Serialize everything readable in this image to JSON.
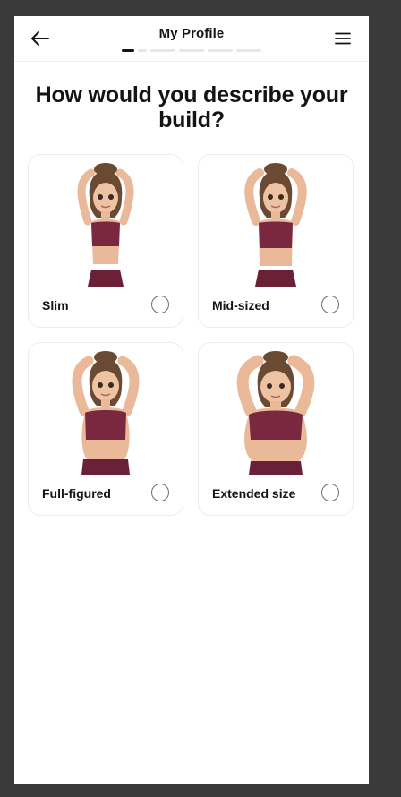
{
  "header": {
    "title": "My Profile",
    "back_icon": "arrow-left-icon",
    "menu_icon": "hamburger-menu-icon",
    "progress": {
      "current_step": 1,
      "total_steps": 5
    }
  },
  "question": "How would you describe your build?",
  "options": [
    {
      "label": "Slim",
      "selected": false,
      "figure_icon": "slim-body-figure"
    },
    {
      "label": "Mid-sized",
      "selected": false,
      "figure_icon": "mid-sized-body-figure"
    },
    {
      "label": "Full-figured",
      "selected": false,
      "figure_icon": "full-figured-body-figure"
    },
    {
      "label": "Extended size",
      "selected": false,
      "figure_icon": "extended-size-body-figure"
    }
  ],
  "colors": {
    "frame_background": "#3a3a3a",
    "screen_background": "#ffffff",
    "text": "#141414",
    "top_color": "#7a2840",
    "skin": "#e9b999",
    "hair": "#6b4a33"
  }
}
